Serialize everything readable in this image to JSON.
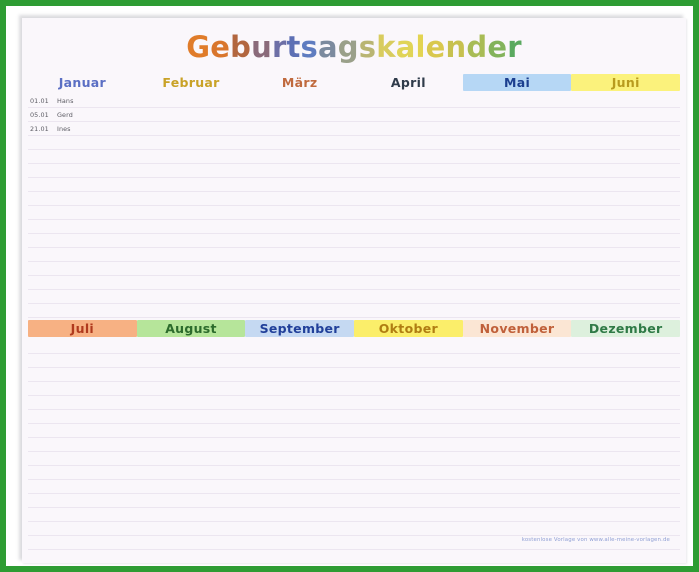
{
  "page": {
    "title_text": "Geburtstagskalender",
    "title_letters": [
      {
        "ch": "G",
        "color": "#e07c2a"
      },
      {
        "ch": "e",
        "color": "#d9762c"
      },
      {
        "ch": "b",
        "color": "#b2663f"
      },
      {
        "ch": "u",
        "color": "#8a6a7a"
      },
      {
        "ch": "r",
        "color": "#6d6fa6"
      },
      {
        "ch": "t",
        "color": "#5d6fb4"
      },
      {
        "ch": "s",
        "color": "#5f7cc0"
      },
      {
        "ch": "a",
        "color": "#7b8a9e"
      },
      {
        "ch": "g",
        "color": "#9aa08a"
      },
      {
        "ch": "s",
        "color": "#b9b573"
      },
      {
        "ch": "k",
        "color": "#d8cc5e"
      },
      {
        "ch": "a",
        "color": "#e0d457"
      },
      {
        "ch": "l",
        "color": "#e3d452"
      },
      {
        "ch": "e",
        "color": "#d9c84e"
      },
      {
        "ch": "n",
        "color": "#c7c14f"
      },
      {
        "ch": "d",
        "color": "#a8bc55"
      },
      {
        "ch": "e",
        "color": "#83b35b"
      },
      {
        "ch": "r",
        "color": "#5aa95f"
      }
    ],
    "frame_color": "#2e9c33",
    "paper_color": "#faf7fb",
    "rule_color": "#ece6f0"
  },
  "footer": {
    "credit": "kostenlose Vorlage von www.alle-meine-vorlagen.de",
    "credit_color": "#8f9fd4"
  },
  "calendar": {
    "rows_per_month_first_half": 16,
    "rows_per_month_second_half": 16,
    "date_column_header": "",
    "name_column_header": "",
    "months": [
      {
        "name": "Januar",
        "text_color": "#5b6fc4",
        "bg_color": "transparent",
        "entries": [
          {
            "date": "01.01",
            "name": "Hans"
          },
          {
            "date": "05.01",
            "name": "Gerd"
          },
          {
            "date": "21.01",
            "name": "Ines"
          }
        ]
      },
      {
        "name": "Februar",
        "text_color": "#c9a227",
        "bg_color": "transparent",
        "entries": []
      },
      {
        "name": "März",
        "text_color": "#c06a3e",
        "bg_color": "transparent",
        "entries": []
      },
      {
        "name": "April",
        "text_color": "#2f3b4a",
        "bg_color": "transparent",
        "entries": []
      },
      {
        "name": "Mai",
        "text_color": "#1c3f8f",
        "bg_color": "#b6d7f5",
        "entries": []
      },
      {
        "name": "Juni",
        "text_color": "#b89b1e",
        "bg_color": "#fbf27c",
        "entries": []
      },
      {
        "name": "Juli",
        "text_color": "#b03a1e",
        "bg_color": "#f7b183",
        "entries": []
      },
      {
        "name": "August",
        "text_color": "#2c6b2c",
        "bg_color": "#b6e59a",
        "entries": []
      },
      {
        "name": "September",
        "text_color": "#21409a",
        "bg_color": "#c5d9f2",
        "entries": []
      },
      {
        "name": "Oktober",
        "text_color": "#b07d12",
        "bg_color": "#fbee6a",
        "entries": []
      },
      {
        "name": "November",
        "text_color": "#c0603a",
        "bg_color": "#fbe6d4",
        "entries": []
      },
      {
        "name": "Dezember",
        "text_color": "#2f7a46",
        "bg_color": "#ddf0dd",
        "entries": []
      }
    ]
  }
}
